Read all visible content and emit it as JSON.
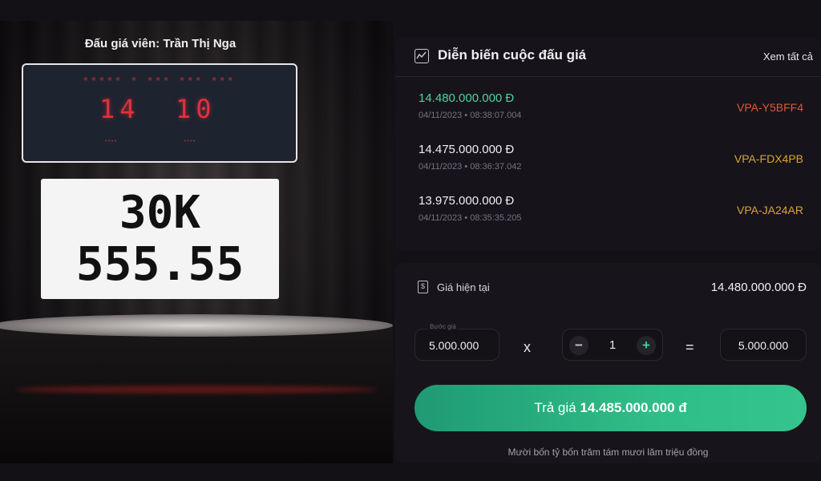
{
  "stage": {
    "auctioneer": "Đấu giá viên: Trần Thị Nga",
    "timer": {
      "minutes": "14",
      "seconds": "10"
    },
    "plate": {
      "line1": "30K",
      "line2": "555.55"
    }
  },
  "history": {
    "title": "Diễn biến cuộc đấu giá",
    "see_all": "Xem tất cả",
    "bids": [
      {
        "amount": "14.480.000.000 Đ",
        "time": "04/11/2023 • 08:38:07.004",
        "user": "VPA-Y5BFF4"
      },
      {
        "amount": "14.475.000.000 Đ",
        "time": "04/11/2023 • 08:36:37.042",
        "user": "VPA-FDX4PB"
      },
      {
        "amount": "13.975.000.000 Đ",
        "time": "04/11/2023 • 08:35:35.205",
        "user": "VPA-JA24AR"
      }
    ]
  },
  "bidding": {
    "current_label": "Giá hiện tại",
    "current_value": "14.480.000.000 Đ",
    "step_label": "Bước giá",
    "step_value": "5.000.000",
    "multiply": "x",
    "minus": "−",
    "quantity": "1",
    "plus": "+",
    "equals": "=",
    "total": "5.000.000",
    "button_prefix": "Trả giá",
    "button_amount": "14.485.000.000 đ",
    "amount_words": "Mười bốn tỷ bốn trăm tám mươi lăm triệu đồng"
  },
  "colors": {
    "accent_green": "#2fbd87",
    "timer_red": "#e2313a",
    "user_red": "#e0563b",
    "user_gold": "#d9a336"
  }
}
